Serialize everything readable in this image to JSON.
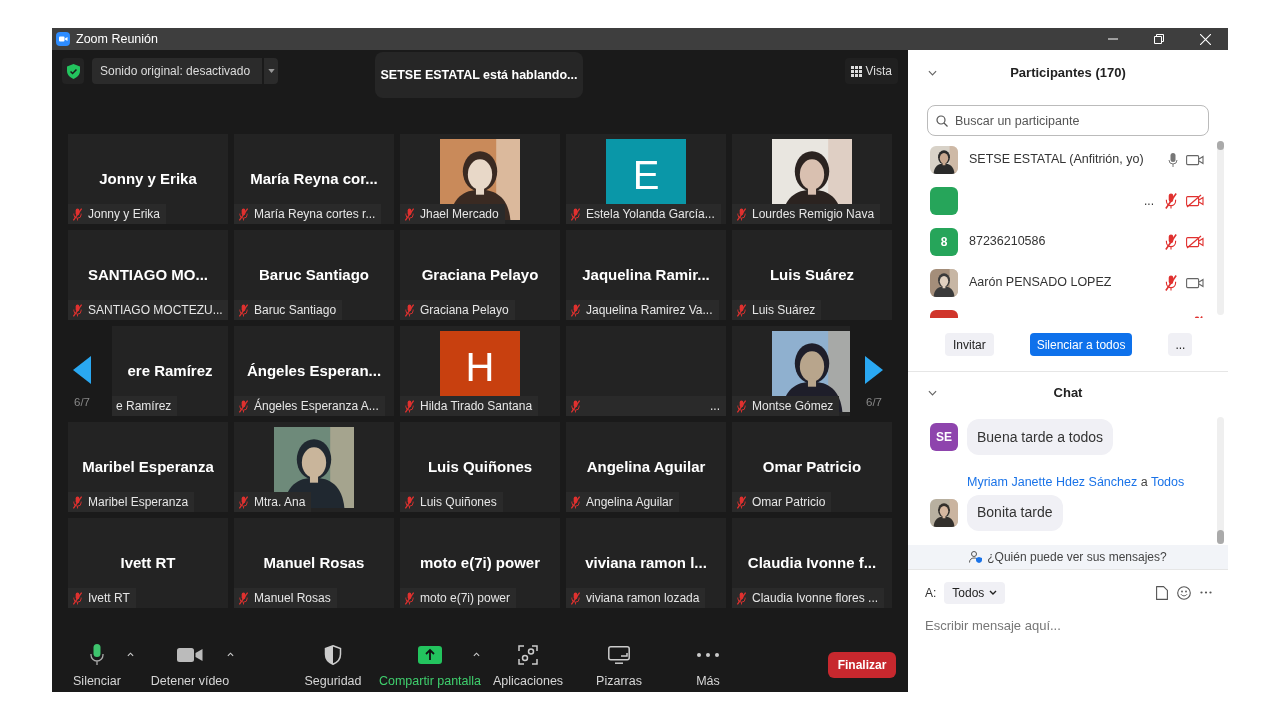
{
  "window": {
    "title": "Zoom Reunión"
  },
  "top_bar": {
    "audio_button": "Sonido original: desactivado",
    "speaking_banner": "SETSE ESTATAL está hablando...",
    "view_button": "Vista"
  },
  "gallery": {
    "page_indicator_left": "6/7",
    "page_indicator_right": "6/7",
    "tiles": [
      {
        "kind": "name",
        "name": "Jonny y Erika",
        "label": "Jonny y Erika",
        "muted": true
      },
      {
        "kind": "name",
        "name": "María Reyna cor...",
        "label": "María Reyna cortes r...",
        "muted": true
      },
      {
        "label": "Jhael Mercado",
        "muted": true
      },
      {
        "kind": "initial",
        "letter": "E",
        "color": "#0a97a8",
        "label": "Estela Yolanda García...",
        "muted": true
      },
      {
        "label": "Lourdes Remigio Nava",
        "muted": true
      },
      {
        "kind": "name",
        "name": "SANTIAGO MO...",
        "label": "SANTIAGO MOCTEZU...",
        "muted": true
      },
      {
        "kind": "name",
        "name": "Baruc Santiago",
        "label": "Baruc Santiago",
        "muted": true
      },
      {
        "kind": "name",
        "name": "Graciana Pelayo",
        "label": "Graciana Pelayo",
        "muted": true
      },
      {
        "kind": "name",
        "name": "Jaquelina Ramir...",
        "label": "Jaquelina Ramirez Va...",
        "muted": true
      },
      {
        "kind": "name",
        "name": "Luis Suárez",
        "label": "Luis Suárez",
        "muted": true
      },
      {
        "kind": "clipped",
        "name": "ere Ramírez",
        "label": "e Ramírez"
      },
      {
        "kind": "name",
        "name": "Ángeles Esperan...",
        "label": "Ángeles Esperanza A...",
        "muted": true
      },
      {
        "kind": "initial",
        "letter": "H",
        "color": "#c8400f",
        "label": "Hilda Tirado Santana",
        "muted": true
      },
      {
        "kind": "empty",
        "label": "...",
        "muted": true
      },
      {
        "kind": "photo_clipped",
        "label": "Montse Gómez",
        "muted": true
      },
      {
        "kind": "name",
        "name": "Maribel Esperanza",
        "label": "Maribel Esperanza",
        "muted": true
      },
      {
        "label": "Mtra. Ana",
        "muted": true
      },
      {
        "kind": "name",
        "name": "Luis Quiñones",
        "label": "Luis Quiñones",
        "muted": true
      },
      {
        "kind": "name",
        "name": "Angelina Aguilar",
        "label": "Angelina Aguilar",
        "muted": true
      },
      {
        "kind": "name",
        "name": "Omar Patricio",
        "label": "Omar Patricio",
        "muted": true
      },
      {
        "kind": "name",
        "name": "Ivett RT",
        "label": "Ivett RT",
        "muted": true
      },
      {
        "kind": "name",
        "name": "Manuel Rosas",
        "label": "Manuel Rosas",
        "muted": true
      },
      {
        "kind": "name",
        "name": "moto e(7i) power",
        "label": "moto e(7i) power",
        "muted": true
      },
      {
        "kind": "name",
        "name": "viviana ramon l...",
        "label": "viviana ramon lozada",
        "muted": true
      },
      {
        "kind": "name",
        "name": "Claudia Ivonne f...",
        "label": "Claudia Ivonne flores ...",
        "muted": true
      }
    ]
  },
  "toolbar": {
    "items": [
      {
        "kind": "mic",
        "label": "Silenciar",
        "menu": true,
        "highlight": false
      },
      {
        "kind": "video",
        "label": "Detener vídeo",
        "menu": true,
        "highlight": false
      },
      {
        "kind": "security",
        "label": "Seguridad",
        "menu": false,
        "highlight": false
      },
      {
        "kind": "share",
        "label": "Compartir pantalla",
        "menu": true,
        "highlight": true
      },
      {
        "kind": "apps",
        "label": "Aplicaciones",
        "menu": false,
        "highlight": false
      },
      {
        "kind": "whiteboard",
        "label": "Pizarras",
        "menu": false,
        "highlight": false
      },
      {
        "kind": "more",
        "label": "Más",
        "menu": false,
        "highlight": false
      }
    ],
    "end_button": "Finalizar"
  },
  "participants": {
    "title": "Participantes (170)",
    "search": {
      "placeholder": "Buscar un participante"
    },
    "list": [
      {
        "name": "SETSE ESTATAL (Anfitrión, yo)",
        "mic_muted": false,
        "video_off": false
      },
      {
        "avatar": {
          "kind": "blank",
          "color": "#26a55a"
        },
        "trailing": "...",
        "mic_muted": true,
        "video_off": true
      },
      {
        "avatar": {
          "kind": "initial",
          "color": "#26a55a",
          "letter": "8"
        },
        "name": "87236210586",
        "mic_muted": true,
        "video_off": true
      },
      {
        "name": "Aarón PENSADO LOPEZ",
        "mic_muted": true,
        "video_off": false
      },
      {
        "avatar": {
          "kind": "blank",
          "color": "#d0352b"
        },
        "mic_muted": true
      }
    ],
    "actions": [
      {
        "label": "Invitar",
        "primary": false
      },
      {
        "label": "Silenciar a todos",
        "primary": true
      },
      {
        "label": "...",
        "primary": false
      }
    ]
  },
  "chat": {
    "title": "Chat",
    "messages": [
      {
        "avatar": {
          "kind": "initial",
          "letter": "SE",
          "color": "#8e44ad"
        },
        "text": "Buena tarde a todos"
      },
      {
        "sender": "Myriam Janette Hdez Sánchez",
        "to_word": "a",
        "recipient": "Todos",
        "text": "Bonita tarde"
      }
    ],
    "privacy_notice": "¿Quién puede ver sus mensajes?",
    "compose": {
      "to_label": "A:",
      "recipient": "Todos",
      "placeholder": "Escribir mensaje aquí..."
    }
  }
}
